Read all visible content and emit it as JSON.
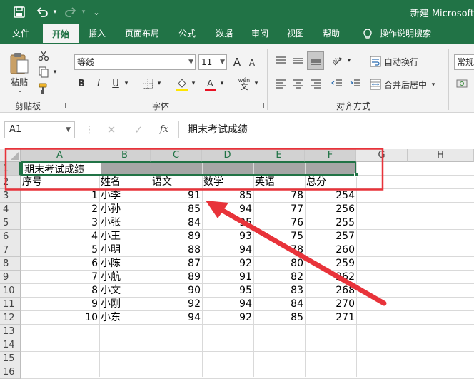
{
  "app": {
    "title": "新建 Microsoft"
  },
  "tabs": [
    "文件",
    "开始",
    "插入",
    "页面布局",
    "公式",
    "数据",
    "审阅",
    "视图",
    "帮助",
    "操作说明搜索"
  ],
  "ribbon": {
    "paste_label": "粘贴",
    "clipboard_group": "剪贴板",
    "font_name": "等线",
    "font_size": "11",
    "font_group": "字体",
    "bold": "B",
    "italic": "I",
    "underline": "U",
    "font_grow": "A",
    "font_shrink": "A",
    "phonetic": "wén",
    "wrap_text": "自动换行",
    "merge_center": "合并后居中",
    "alignment_group": "对齐方式",
    "number_format": "常规"
  },
  "formula_bar": {
    "name_box": "A1",
    "fx": "fx",
    "content": "期末考试成绩"
  },
  "sheet": {
    "columns": [
      "A",
      "B",
      "C",
      "D",
      "E",
      "F",
      "G",
      "H"
    ],
    "row_numbers": [
      "1",
      "2",
      "3",
      "4",
      "5",
      "6",
      "7",
      "8",
      "9",
      "10",
      "11",
      "12",
      "13",
      "14",
      "15",
      "16"
    ],
    "title": "期末考试成绩",
    "headers": [
      "序号",
      "姓名",
      "语文",
      "数学",
      "英语",
      "总分"
    ],
    "rows": [
      [
        "1",
        "小李",
        "91",
        "85",
        "78",
        "254"
      ],
      [
        "2",
        "小孙",
        "85",
        "94",
        "77",
        "256"
      ],
      [
        "3",
        "小张",
        "84",
        "95",
        "76",
        "255"
      ],
      [
        "4",
        "小王",
        "89",
        "93",
        "75",
        "257"
      ],
      [
        "5",
        "小明",
        "88",
        "94",
        "78",
        "260"
      ],
      [
        "6",
        "小陈",
        "87",
        "92",
        "80",
        "259"
      ],
      [
        "7",
        "小航",
        "89",
        "91",
        "82",
        "262"
      ],
      [
        "8",
        "小文",
        "90",
        "95",
        "83",
        "268"
      ],
      [
        "9",
        "小刚",
        "92",
        "94",
        "84",
        "270"
      ],
      [
        "10",
        "小东",
        "94",
        "92",
        "85",
        "271"
      ]
    ]
  },
  "colors": {
    "excel_green": "#217346",
    "annotation_red": "#e8333a",
    "merged_fill": "#a6a6a6"
  }
}
